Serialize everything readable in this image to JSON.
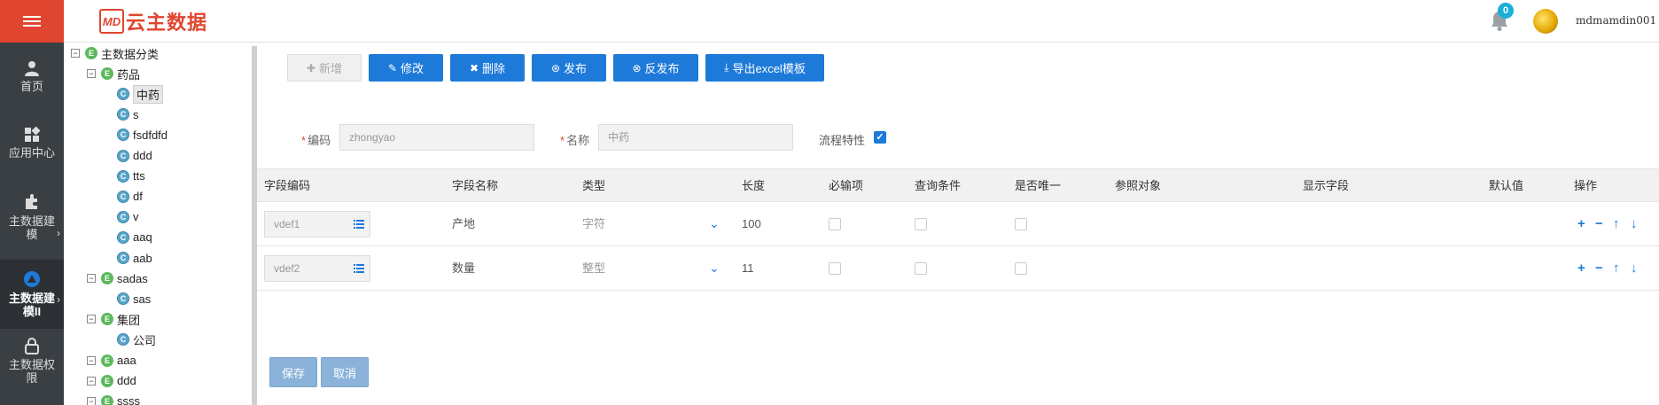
{
  "app": {
    "logo_mark": "MD",
    "logo_text": "云主数据",
    "notification_count": "0",
    "username": "mdmamdin001"
  },
  "nav": [
    {
      "label": "首页",
      "icon": "user-icon",
      "active": false
    },
    {
      "label": "应用中心",
      "icon": "apps-icon",
      "active": false
    },
    {
      "label": "主数据建模",
      "icon": "puzzle-icon",
      "active": false
    },
    {
      "label": "主数据建模II",
      "icon": "modeling-icon",
      "active": true
    },
    {
      "label": "主数据权限",
      "icon": "lock-icon",
      "active": false
    }
  ],
  "tree": {
    "root": "主数据分类",
    "nodes": [
      {
        "label": "药品",
        "icon": "E",
        "level": 1,
        "expanded": true
      },
      {
        "label": "中药",
        "icon": "C",
        "level": 2,
        "selected": true
      },
      {
        "label": "s",
        "icon": "C",
        "level": 2
      },
      {
        "label": "fsdfdfd",
        "icon": "C",
        "level": 2
      },
      {
        "label": "ddd",
        "icon": "C",
        "level": 2
      },
      {
        "label": "tts",
        "icon": "C",
        "level": 2
      },
      {
        "label": "df",
        "icon": "C",
        "level": 2
      },
      {
        "label": "v",
        "icon": "C",
        "level": 2
      },
      {
        "label": "aaq",
        "icon": "C",
        "level": 2
      },
      {
        "label": "aab",
        "icon": "C",
        "level": 2
      },
      {
        "label": "sadas",
        "icon": "E",
        "level": 1,
        "expanded": true
      },
      {
        "label": "sas",
        "icon": "C",
        "level": 2
      },
      {
        "label": "集团",
        "icon": "E",
        "level": 1,
        "expanded": true
      },
      {
        "label": "公司",
        "icon": "C",
        "level": 2
      },
      {
        "label": "aaa",
        "icon": "E",
        "level": 1,
        "expanded": true
      },
      {
        "label": "ddd",
        "icon": "E",
        "level": 1,
        "expanded": true
      },
      {
        "label": "ssss",
        "icon": "E",
        "level": 1,
        "expanded": true
      }
    ]
  },
  "toolbar": {
    "add": "新增",
    "edit": "修改",
    "delete": "删除",
    "publish": "发布",
    "unpublish": "反发布",
    "export": "导出excel模板"
  },
  "form": {
    "code_label": "编码",
    "code_value": "zhongyao",
    "name_label": "名称",
    "name_value": "中药",
    "flow_label": "流程特性",
    "flow_checked": true
  },
  "table": {
    "headers": [
      "字段编码",
      "字段名称",
      "类型",
      "长度",
      "必输项",
      "查询条件",
      "是否唯一",
      "参照对象",
      "显示字段",
      "默认值",
      "操作"
    ],
    "rows": [
      {
        "code": "vdef1",
        "name": "产地",
        "type": "字符",
        "length": "100",
        "required": false,
        "query": false,
        "unique": false,
        "ref": "",
        "display": "",
        "default": ""
      },
      {
        "code": "vdef2",
        "name": "数量",
        "type": "整型",
        "length": "11",
        "required": false,
        "query": false,
        "unique": false,
        "ref": "",
        "display": "",
        "default": ""
      }
    ]
  },
  "actions": {
    "save": "保存",
    "cancel": "取消"
  }
}
